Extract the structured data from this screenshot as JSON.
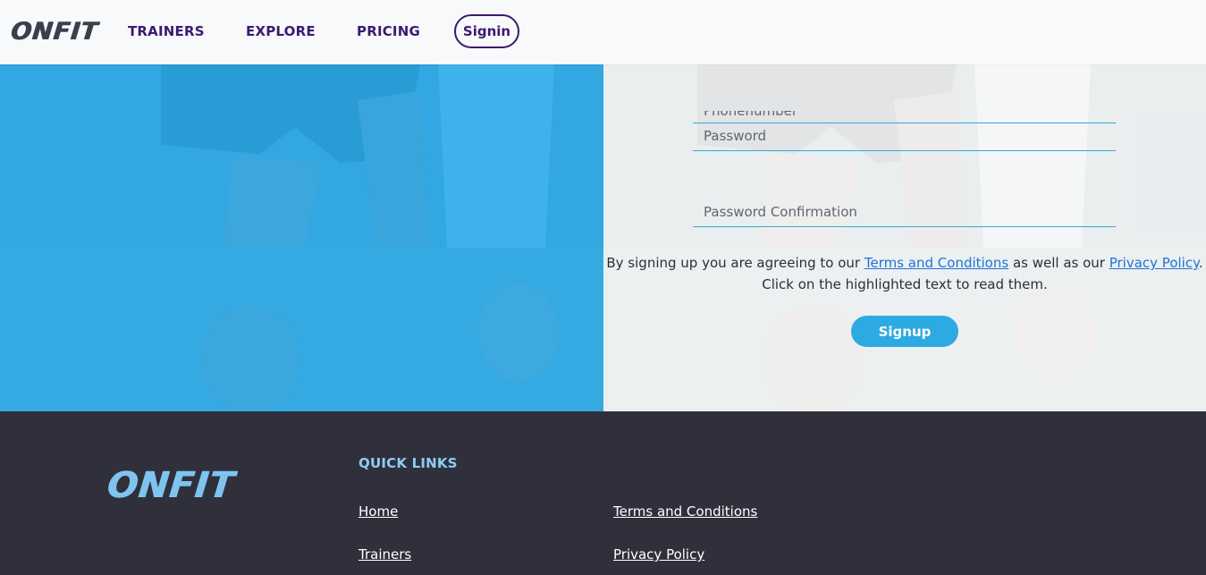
{
  "header": {
    "brand": "ONFIT",
    "nav": {
      "trainers": "TRAINERS",
      "explore": "EXPLORE",
      "pricing": "PRICING",
      "signin": "Signin"
    }
  },
  "form": {
    "phone_placeholder": "Phonenumber",
    "password_placeholder": "Password",
    "password_confirm_placeholder": "Password Confirmation",
    "terms_prefix": "By signing up you are agreeing to our ",
    "terms_link": "Terms and Conditions",
    "terms_middle": " as well as our ",
    "privacy_link": "Privacy Policy",
    "terms_suffix": ".",
    "terms_line2": "Click on the highlighted text to read them.",
    "signup_label": "Signup"
  },
  "footer": {
    "brand": "ONFIT",
    "quick_links_title": "QUICK LINKS",
    "links": {
      "home": "Home",
      "terms": "Terms and Conditions",
      "trainers": "Trainers",
      "privacy": "Privacy Policy"
    }
  },
  "colors": {
    "accent": "#2eaae3",
    "nav_text": "#3c1a6e",
    "footer_bg": "#30303c",
    "footer_title": "#8dcdf3"
  },
  "icons": [
    "photo-background"
  ]
}
